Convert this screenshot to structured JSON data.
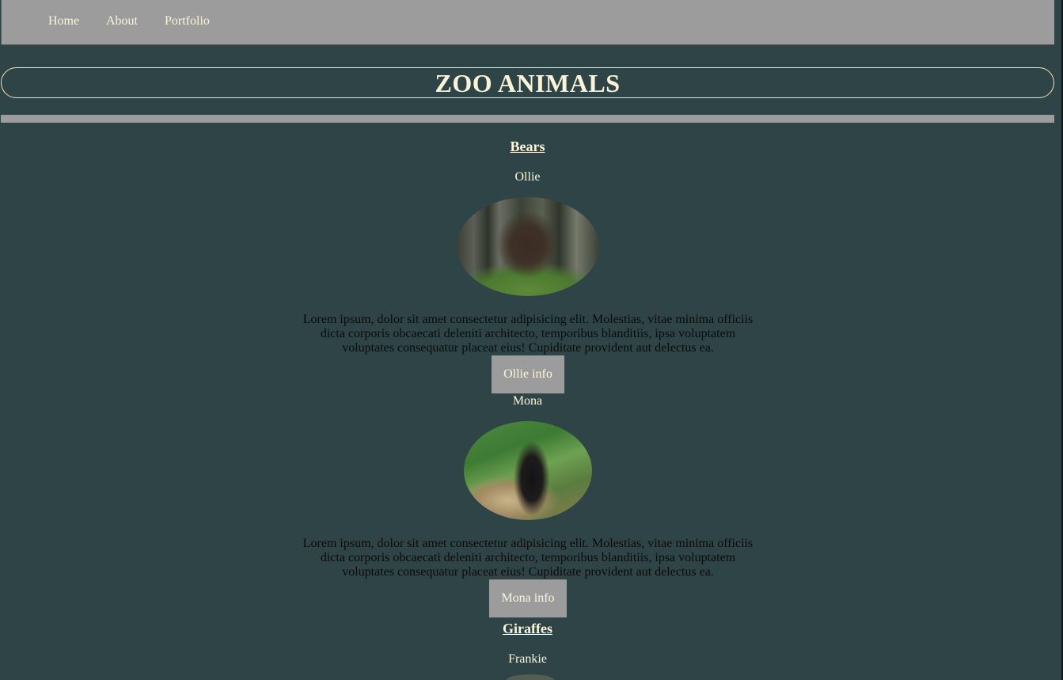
{
  "nav": {
    "links": [
      "Home",
      "About",
      "Portfolio"
    ]
  },
  "header": {
    "title": "ZOO ANIMALS"
  },
  "sections": [
    {
      "heading": "Bears",
      "animals": [
        {
          "name": "Ollie",
          "photo_icon": "brown-bear-photo",
          "description": "Lorem ipsum, dolor sit amet consectetur adipisicing elit. Molestias, vitae minima officiis dicta corporis obcaecati deleniti architecto, temporibus blanditiis, ipsa voluptatem voluptates consequatur placeat eius! Cupiditate provident aut delectus ea.",
          "button_label": "Ollie info"
        },
        {
          "name": "Mona",
          "photo_icon": "black-bear-photo",
          "description": "Lorem ipsum, dolor sit amet consectetur adipisicing elit. Molestias, vitae minima officiis dicta corporis obcaecati deleniti architecto, temporibus blanditiis, ipsa voluptatem voluptates consequatur placeat eius! Cupiditate provident aut delectus ea.",
          "button_label": "Mona info"
        }
      ]
    },
    {
      "heading": "Giraffes",
      "animals": [
        {
          "name": "Frankie"
        }
      ]
    }
  ],
  "colors": {
    "background": "#2e4446",
    "nav_bar": "#9c9c9c",
    "accent_text": "#fbf5dc",
    "title_border": "#f2e3b5",
    "body_text": "#0b0b0b"
  }
}
